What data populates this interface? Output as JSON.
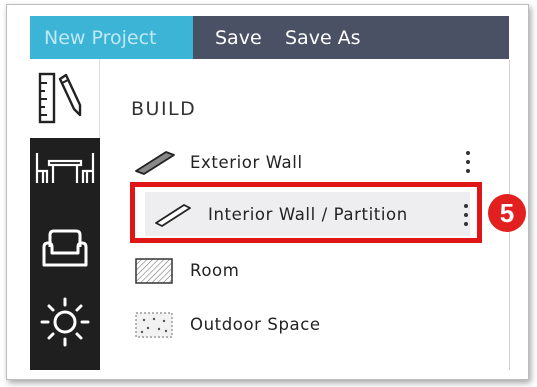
{
  "topbar": {
    "new_project": "New Project",
    "save": "Save",
    "save_as": "Save As"
  },
  "sidebar": {
    "icons": [
      "ruler-pencil-icon",
      "dining-table-icon",
      "armchair-icon",
      "sun-icon"
    ]
  },
  "panel": {
    "title": "BUILD",
    "items": [
      {
        "label": "Exterior Wall",
        "icon": "exterior-wall-icon"
      },
      {
        "label": "Interior Wall / Partition",
        "icon": "interior-wall-icon"
      },
      {
        "label": "Room",
        "icon": "room-hatch-icon"
      },
      {
        "label": "Outdoor Space",
        "icon": "outdoor-space-icon"
      }
    ]
  },
  "annotation": {
    "step_number": "5",
    "highlight_color": "#e01515"
  },
  "colors": {
    "topbar": "#4b5164",
    "active_tab": "#3bb4d6",
    "sidebar": "#1f1f1f"
  }
}
